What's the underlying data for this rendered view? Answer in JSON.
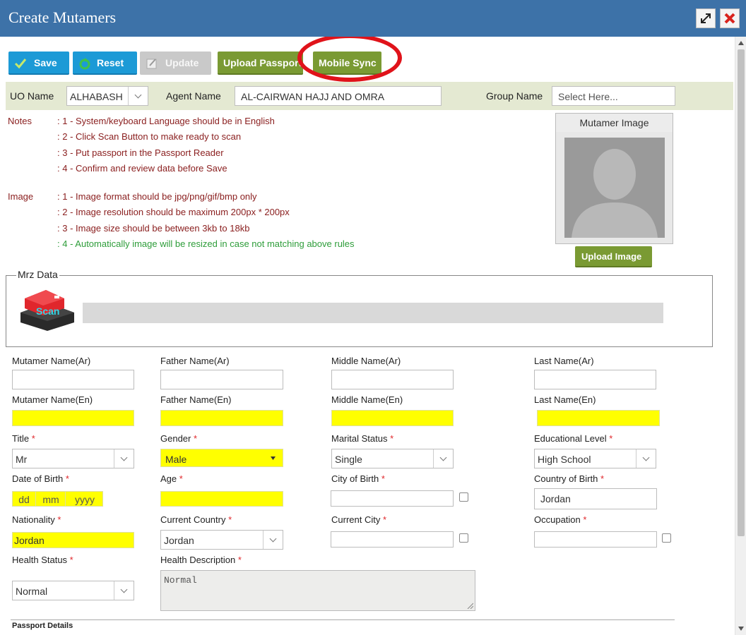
{
  "window": {
    "title": "Create Mutamers"
  },
  "toolbar": {
    "save": "Save",
    "reset": "Reset",
    "update": "Update",
    "upload_passport": "Upload Passport",
    "mobile_sync": "Mobile Sync"
  },
  "info": {
    "uo_label": "UO Name",
    "uo_value": "ALHABASH",
    "agent_label": "Agent Name",
    "agent_value": "AL-CAIRWAN HAJJ AND OMRA",
    "group_label": "Group Name",
    "group_placeholder": "Select Here..."
  },
  "notes": {
    "label": "Notes",
    "items": [
      ": 1 - System/keyboard Language should be in English",
      ": 2 - Click Scan Button to make ready to scan",
      ": 3 - Put passport in the Passport Reader",
      ": 4 - Confirm and review data before Save"
    ]
  },
  "image_notes": {
    "label": "Image",
    "items": [
      ": 1 - Image format should be jpg/png/gif/bmp only",
      ": 2 - Image resolution should be maximum 200px * 200px",
      ": 3 - Image size should be between 3kb to 18kb",
      ": 4 - Automatically image will be resized in case not matching above rules"
    ]
  },
  "mutamer_image": {
    "title": "Mutamer Image",
    "upload": "Upload Image"
  },
  "mrz": {
    "legend": "Mrz Data",
    "scan_label": "Scan"
  },
  "form": {
    "mutamer_name_ar": "Mutamer Name(Ar)",
    "father_name_ar": "Father Name(Ar)",
    "middle_name_ar": "Middle Name(Ar)",
    "last_name_ar": "Last Name(Ar)",
    "mutamer_name_en": "Mutamer Name(En)",
    "father_name_en": "Father Name(En)",
    "middle_name_en": "Middle Name(En)",
    "last_name_en": "Last Name(En)",
    "title_label": "Title",
    "title_value": "Mr",
    "gender_label": "Gender",
    "gender_value": "Male",
    "marital_label": "Marital Status",
    "marital_value": "Single",
    "education_label": "Educational Level",
    "education_value": "High School",
    "dob_label": "Date of Birth",
    "dob_dd": "dd",
    "dob_mm": "mm",
    "dob_yyyy": "yyyy",
    "age_label": "Age",
    "city_birth_label": "City of Birth",
    "country_birth_label": "Country of Birth",
    "country_birth_value": "Jordan",
    "nationality_label": "Nationality",
    "nationality_value": "Jordan",
    "current_country_label": "Current Country",
    "current_country_value": "Jordan",
    "current_city_label": "Current City",
    "occupation_label": "Occupation",
    "health_status_label": "Health Status",
    "health_status_value": "Normal",
    "health_desc_label": "Health Description",
    "health_desc_value": "Normal",
    "required_mark": "*"
  },
  "section": {
    "passport_details": "Passport Details"
  },
  "colors": {
    "titlebar": "#3d72a8",
    "highlight": "#e0131a",
    "required": "#ffff00"
  }
}
